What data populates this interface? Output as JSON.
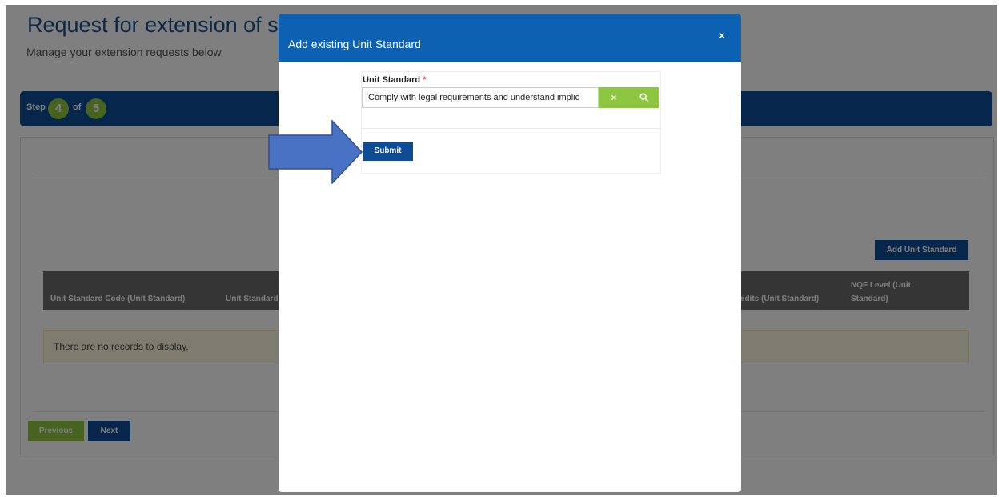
{
  "page": {
    "title": "Request for extension of sc",
    "subtitle": "Manage your extension requests below"
  },
  "stepper": {
    "step_label": "Step",
    "current": "4",
    "of_label": "of",
    "total": "5"
  },
  "content": {
    "add_unit_button": "Add Unit Standard",
    "table_headers": [
      "Unit Standard Code (Unit Standard)",
      "Unit Standard",
      "redits (Unit Standard)",
      "NQF Level (Unit",
      "Standard)"
    ],
    "empty_message": "There are no records to display.",
    "previous_button": "Previous",
    "next_button": "Next"
  },
  "modal": {
    "title": "Add existing Unit Standard",
    "close_icon": "×",
    "field_label": "Unit Standard",
    "required_mark": "*",
    "input_value": "Comply with legal requirements and understand implic",
    "clear_icon": "×",
    "search_icon": "magnifier",
    "submit_button": "Submit"
  },
  "colors": {
    "primary": "#0d4c97",
    "modal_header": "#0d61b3",
    "accent_green": "#8dc63f",
    "annotation_arrow": "#4a72c4"
  }
}
